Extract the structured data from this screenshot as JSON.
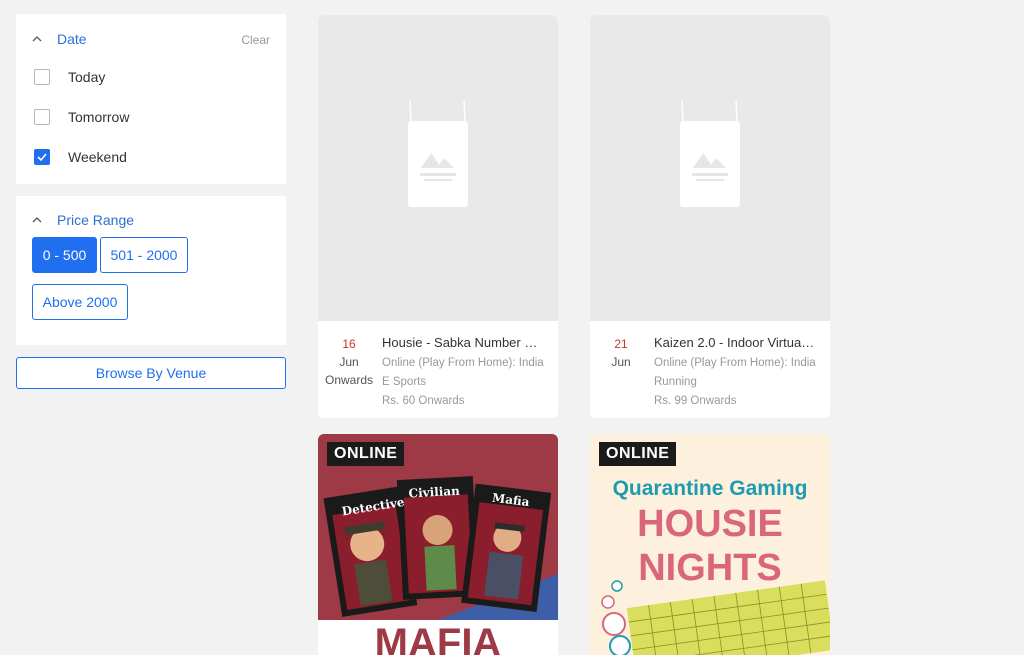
{
  "filters": {
    "date": {
      "title": "Date",
      "clear_label": "Clear",
      "options": [
        {
          "label": "Today",
          "checked": false
        },
        {
          "label": "Tomorrow",
          "checked": false
        },
        {
          "label": "Weekend",
          "checked": true
        }
      ]
    },
    "price": {
      "title": "Price Range",
      "options": [
        {
          "label": "0 - 500",
          "active": true
        },
        {
          "label": "501 - 2000",
          "active": false
        },
        {
          "label": "Above 2000",
          "active": false
        }
      ]
    }
  },
  "browse_venue_label": "Browse By Venue",
  "events": [
    {
      "day": "16",
      "month": "Jun",
      "suffix": "Onwards",
      "title": "Housie - Sabka Number …",
      "venue": "Online (Play From Home): India",
      "category": "E Sports",
      "price": "Rs. 60 Onwards"
    },
    {
      "day": "21",
      "month": "Jun",
      "suffix": "",
      "title": "Kaizen 2.0 - Indoor Virtua…",
      "venue": "Online (Play From Home): India",
      "category": "Running",
      "price": "Rs. 99 Onwards"
    }
  ],
  "posters": [
    {
      "badge": "ONLINE",
      "card_labels": [
        "Detective",
        "Civilian",
        "Mafia"
      ],
      "title": "MAFIA"
    },
    {
      "badge": "ONLINE",
      "subtitle": "Quarantine Gaming",
      "title_line1": "HOUSIE",
      "title_line2": "NIGHTS"
    }
  ],
  "colors": {
    "accent": "#1f6ff0",
    "date_day": "#c0392b",
    "mafia_red": "#9e3a46",
    "housie_teal": "#1e9bb0",
    "housie_pink": "#d9667a"
  }
}
